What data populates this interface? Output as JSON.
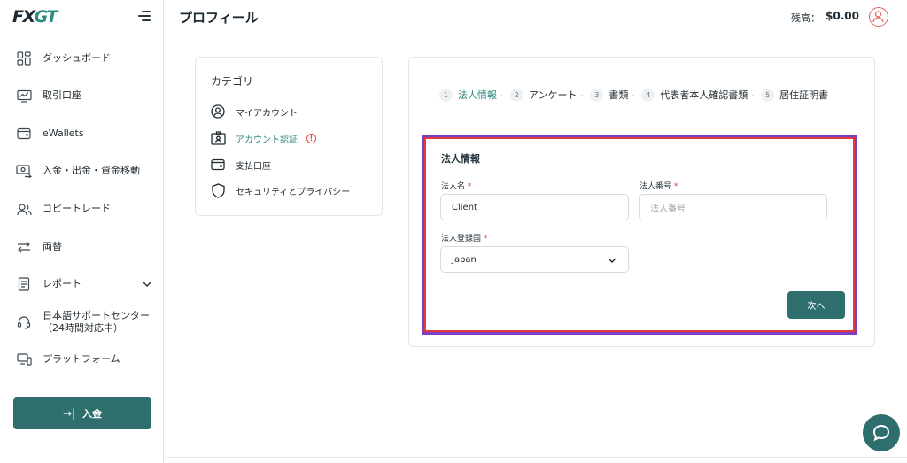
{
  "brand": {
    "logo_prefix": "FX",
    "logo_accent": "GT"
  },
  "sidebar": {
    "items": [
      {
        "label": "ダッシュボード",
        "icon": "dashboard-icon"
      },
      {
        "label": "取引口座",
        "icon": "trading-account-icon"
      },
      {
        "label": "eWallets",
        "icon": "wallet-icon"
      },
      {
        "label": "入金・出金・資金移動",
        "icon": "funds-transfer-icon"
      },
      {
        "label": "コピートレード",
        "icon": "copy-trade-icon"
      },
      {
        "label": "両替",
        "icon": "exchange-icon"
      },
      {
        "label": "レポート",
        "icon": "report-icon"
      },
      {
        "label": "日本語サポートセンター",
        "label2": "（24時間対応中）",
        "icon": "support-headset-icon"
      },
      {
        "label": "プラットフォーム",
        "icon": "platform-icon"
      }
    ],
    "deposit_label": "入金"
  },
  "header": {
    "title": "プロフィール",
    "balance_label": "残高：",
    "balance_value": "$0.00"
  },
  "category": {
    "title": "カテゴリ",
    "items": [
      {
        "label": "マイアカウント",
        "icon": "user-circle-icon"
      },
      {
        "label": "アカウント認証",
        "icon": "id-card-icon",
        "active": true,
        "warning": "!"
      },
      {
        "label": "支払口座",
        "icon": "wallet-icon"
      },
      {
        "label": "セキュリティとプライバシー",
        "icon": "shield-icon"
      }
    ]
  },
  "steps": [
    {
      "num": "1",
      "label": "法人情報",
      "active": true
    },
    {
      "num": "2",
      "label": "アンケート"
    },
    {
      "num": "3",
      "label": "書類"
    },
    {
      "num": "4",
      "label": "代表者本人確認書類"
    },
    {
      "num": "5",
      "label": "居住証明書"
    }
  ],
  "form": {
    "title": "法人情報",
    "company_name": {
      "label": "法人名",
      "required": "*",
      "value": "Client"
    },
    "company_number": {
      "label": "法人番号",
      "required": "*",
      "placeholder": "法人番号"
    },
    "country": {
      "label": "法人登録国",
      "required": "*",
      "value": "Japan"
    },
    "next_label": "次へ"
  },
  "colors": {
    "accent": "#2e6e6c",
    "active_text": "#2f8a80",
    "required": "#d93a3a",
    "highlight_outer": "#7a3fc4",
    "highlight_inner": "#e03b3b"
  }
}
